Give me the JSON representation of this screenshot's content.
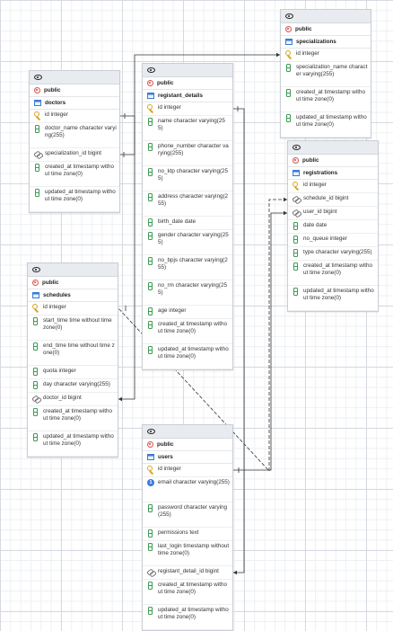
{
  "colors": {
    "pk": "#d9a520",
    "column": "#3c9b52",
    "schema": "#d9534f",
    "table": "#3a7bd5",
    "link": "#333333"
  },
  "icons": {
    "header": "eye-icon",
    "schema": "schema-icon",
    "table": "table-icon",
    "pk": "key-icon",
    "fk": "fk-icon",
    "column": "column-icon",
    "unique": "unique-icon"
  },
  "tables": [
    {
      "id": "specializations",
      "schema": "public",
      "name": "specializations",
      "columns": [
        {
          "kind": "pk",
          "text": "id integer"
        },
        {
          "kind": "column",
          "text": "specialization_name character varying(255)"
        },
        {
          "kind": "column",
          "text": "created_at timestamp without time zone(0)"
        },
        {
          "kind": "column",
          "text": "updated_at timestamp without time zone(0)"
        }
      ]
    },
    {
      "id": "doctors",
      "schema": "public",
      "name": "doctors",
      "columns": [
        {
          "kind": "pk",
          "text": "id integer"
        },
        {
          "kind": "column",
          "text": "doctor_name character varying(255)"
        },
        {
          "kind": "fk",
          "text": "specialization_id bigint"
        },
        {
          "kind": "column",
          "text": "created_at timestamp without time zone(0)"
        },
        {
          "kind": "column",
          "text": "updated_at timestamp without time zone(0)"
        }
      ]
    },
    {
      "id": "registant_details",
      "schema": "public",
      "name": "registant_details",
      "columns": [
        {
          "kind": "pk",
          "text": "id integer"
        },
        {
          "kind": "column",
          "text": "name character varying(255)"
        },
        {
          "kind": "column",
          "text": "phone_number character varying(255)"
        },
        {
          "kind": "column",
          "text": "no_ktp character varying(255)"
        },
        {
          "kind": "column",
          "text": "address character varying(255)"
        },
        {
          "kind": "column",
          "text": "birth_date date"
        },
        {
          "kind": "column",
          "text": "gender character varying(255)"
        },
        {
          "kind": "column",
          "text": "no_bpjs character varying(255)"
        },
        {
          "kind": "column",
          "text": "no_rm character varying(255)"
        },
        {
          "kind": "column",
          "text": "age integer"
        },
        {
          "kind": "column",
          "text": "created_at timestamp without time zone(0)"
        },
        {
          "kind": "column",
          "text": "updated_at timestamp without time zone(0)"
        }
      ]
    },
    {
      "id": "registrations",
      "schema": "public",
      "name": "registrations",
      "columns": [
        {
          "kind": "pk",
          "text": "id integer"
        },
        {
          "kind": "fk",
          "text": "schedule_id bigint"
        },
        {
          "kind": "fk",
          "text": "user_id bigint"
        },
        {
          "kind": "column",
          "text": "date date"
        },
        {
          "kind": "column",
          "text": "no_queue integer"
        },
        {
          "kind": "column",
          "text": "type character varying(255)"
        },
        {
          "kind": "column",
          "text": "created_at timestamp without time zone(0)"
        },
        {
          "kind": "column",
          "text": "updated_at timestamp without time zone(0)"
        }
      ]
    },
    {
      "id": "schedules",
      "schema": "public",
      "name": "schedules",
      "columns": [
        {
          "kind": "pk",
          "text": "id integer"
        },
        {
          "kind": "column",
          "text": "start_time time without time zone(0)"
        },
        {
          "kind": "column",
          "text": "end_time time without time zone(0)"
        },
        {
          "kind": "column",
          "text": "quota integer"
        },
        {
          "kind": "column",
          "text": "day character varying(255)"
        },
        {
          "kind": "fk",
          "text": "doctor_id bigint"
        },
        {
          "kind": "column",
          "text": "created_at timestamp without time zone(0)"
        },
        {
          "kind": "column",
          "text": "updated_at timestamp without time zone(0)"
        }
      ]
    },
    {
      "id": "users",
      "schema": "public",
      "name": "users",
      "columns": [
        {
          "kind": "pk",
          "text": "id integer"
        },
        {
          "kind": "unique",
          "text": "email character varying(255)"
        },
        {
          "kind": "column",
          "text": "password character varying(255)"
        },
        {
          "kind": "column",
          "text": "permissions text"
        },
        {
          "kind": "column",
          "text": "last_login timestamp without time zone(0)"
        },
        {
          "kind": "fk",
          "text": "registant_detail_id bigint"
        },
        {
          "kind": "column",
          "text": "created_at timestamp without time zone(0)"
        },
        {
          "kind": "column",
          "text": "updated_at timestamp without time zone(0)"
        }
      ]
    }
  ],
  "relations": [
    {
      "from": "doctors.specialization_id",
      "to": "specializations.id"
    },
    {
      "from": "schedules.doctor_id",
      "to": "doctors.id"
    },
    {
      "from": "registrations.schedule_id",
      "to": "schedules.id"
    },
    {
      "from": "registrations.user_id",
      "to": "users.id"
    },
    {
      "from": "users.registant_detail_id",
      "to": "registant_details.id"
    }
  ]
}
